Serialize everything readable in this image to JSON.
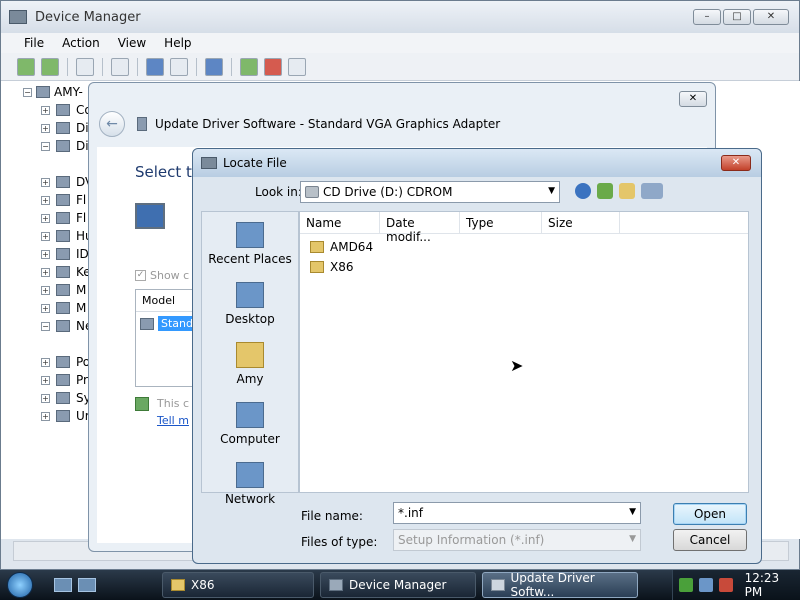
{
  "device_manager": {
    "title": "Device Manager",
    "menus": [
      "File",
      "Action",
      "View",
      "Help"
    ],
    "root": "AMY-",
    "tree": [
      "Co",
      "Di",
      "Di",
      "DV",
      "Fl",
      "Fl",
      "Hu",
      "ID",
      "Ke",
      "M",
      "M",
      "Ne",
      "Po",
      "Pr",
      "Sy",
      "Ur"
    ]
  },
  "wizard": {
    "title": "Update Driver Software - Standard VGA Graphics Adapter",
    "heading": "Select th",
    "show_compatible": "Show c",
    "model_header": "Model",
    "model_selected": "Stand",
    "hint_line1": "This c",
    "hint_link": "Tell m"
  },
  "locate_file": {
    "title": "Locate File",
    "look_in_label": "Look in:",
    "look_in_value": "CD Drive (D:) CDROM",
    "places": [
      "Recent Places",
      "Desktop",
      "Amy",
      "Computer",
      "Network"
    ],
    "columns": [
      "Name",
      "Date modif...",
      "Type",
      "Size"
    ],
    "files": [
      "AMD64",
      "X86"
    ],
    "file_name_label": "File name:",
    "file_name_value": "*.inf",
    "files_of_type_label": "Files of type:",
    "files_of_type_value": "Setup Information (*.inf)",
    "open_label": "Open",
    "cancel_label": "Cancel"
  },
  "taskbar": {
    "tasks": [
      "X86",
      "Device Manager",
      "Update Driver Softw..."
    ],
    "clock": "12:23 PM"
  },
  "colors": {
    "selection": "#3399ff",
    "heading_blue": "#1e3a6e",
    "link_blue": "#1a56c8"
  }
}
